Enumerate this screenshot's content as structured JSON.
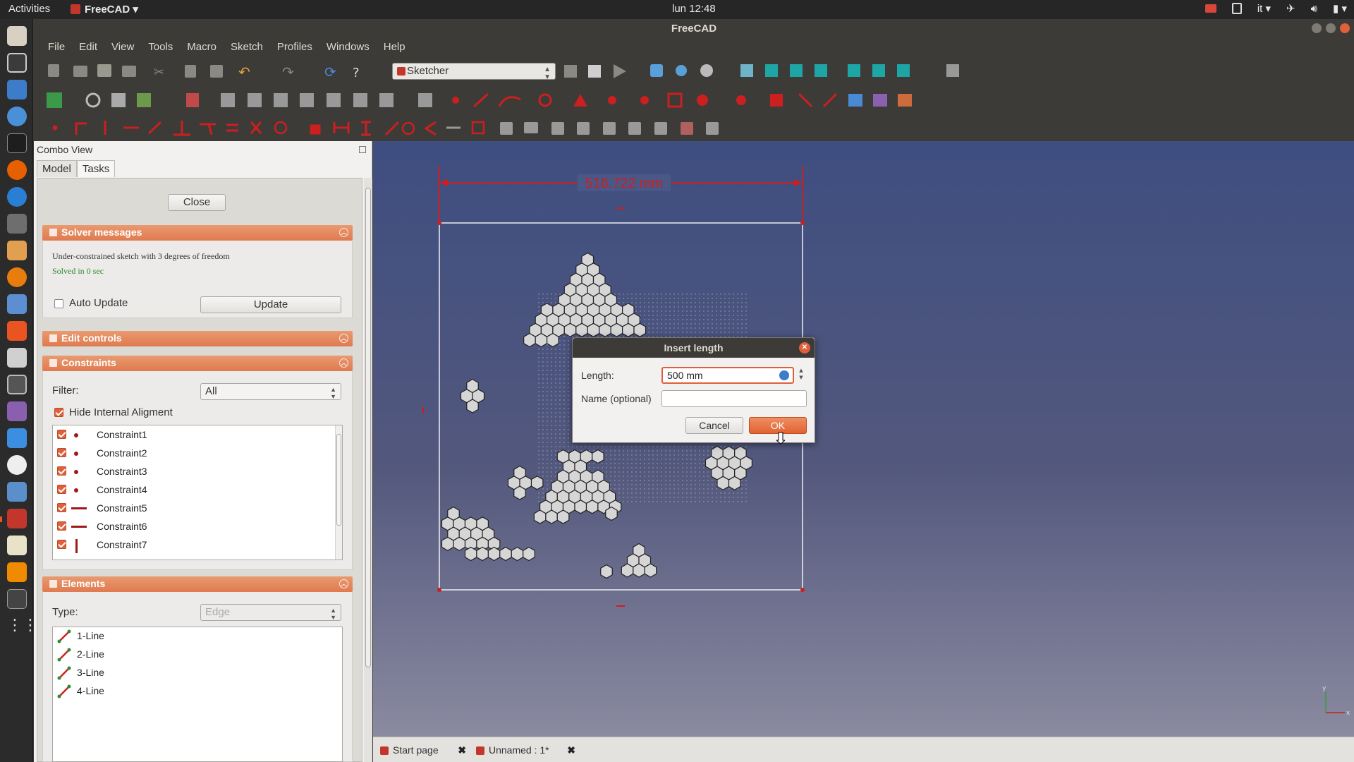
{
  "topbar": {
    "activities": "Activities",
    "app_name": "FreeCAD",
    "clock": "lun 12:48",
    "keyboard": "it"
  },
  "window": {
    "title": "FreeCAD"
  },
  "menu": [
    "File",
    "Edit",
    "View",
    "Tools",
    "Macro",
    "Sketch",
    "Profiles",
    "Windows",
    "Help"
  ],
  "toolbar": {
    "workbench": "Sketcher"
  },
  "combo": {
    "title": "Combo View",
    "tabs": {
      "model": "Model",
      "tasks": "Tasks"
    },
    "close_label": "Close",
    "solver": {
      "title": "Solver messages",
      "message": "Under-constrained sketch with 3 degrees of freedom",
      "solved": "Solved in 0 sec",
      "auto_update": "Auto Update",
      "update_label": "Update"
    },
    "edit_controls": {
      "title": "Edit controls"
    },
    "constraints": {
      "title": "Constraints",
      "filter_label": "Filter:",
      "filter_value": "All",
      "hide_internal": "Hide Internal Aligment",
      "items": [
        {
          "label": "Constraint1",
          "icon": "dot"
        },
        {
          "label": "Constraint2",
          "icon": "dot"
        },
        {
          "label": "Constraint3",
          "icon": "dot"
        },
        {
          "label": "Constraint4",
          "icon": "dot"
        },
        {
          "label": "Constraint5",
          "icon": "hbar"
        },
        {
          "label": "Constraint6",
          "icon": "hbar"
        },
        {
          "label": "Constraint7",
          "icon": "vbar"
        }
      ]
    },
    "elements": {
      "title": "Elements",
      "type_label": "Type:",
      "type_value": "Edge",
      "items": [
        "1-Line",
        "2-Line",
        "3-Line",
        "4-Line"
      ]
    }
  },
  "view": {
    "dimension_label": "516.722 mm"
  },
  "dialog": {
    "title": "Insert length",
    "length_label": "Length:",
    "length_value": "500 mm",
    "name_label": "Name (optional)",
    "name_value": "",
    "cancel_label": "Cancel",
    "ok_label": "OK"
  },
  "doc_tabs": {
    "start": "Start page",
    "unnamed": "Unnamed : 1*"
  },
  "colors": {
    "accent": "#e0603a",
    "sketch_red": "#cc1f1f",
    "view_top": "#3e4e80"
  }
}
